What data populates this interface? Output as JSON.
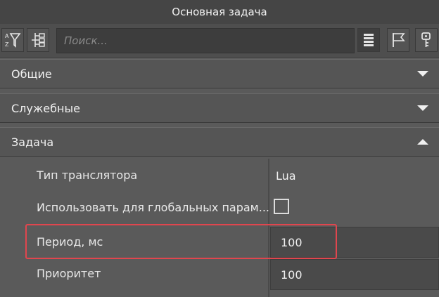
{
  "window": {
    "title": "Основная задача"
  },
  "toolbar": {
    "search_placeholder": "Поиск...",
    "sort_icon": "sort-az-filter-icon",
    "tree_icon": "tree-structure-icon",
    "list_icon": "list-view-icon",
    "flag_icon": "flag-icon",
    "key_icon": "key-icon"
  },
  "sections": [
    {
      "label": "Общие",
      "expanded": false
    },
    {
      "label": "Служебные",
      "expanded": false
    },
    {
      "label": "Задача",
      "expanded": true
    }
  ],
  "properties": [
    {
      "label": "Тип транслятора",
      "value": "Lua"
    },
    {
      "label": "Использовать для глобальных парам...",
      "value": false
    },
    {
      "label": "Период, мс",
      "value": "100"
    },
    {
      "label": "Приоритет",
      "value": "100"
    }
  ],
  "colors": {
    "highlight": "#e0464e",
    "panel": "#5a5a5a"
  }
}
